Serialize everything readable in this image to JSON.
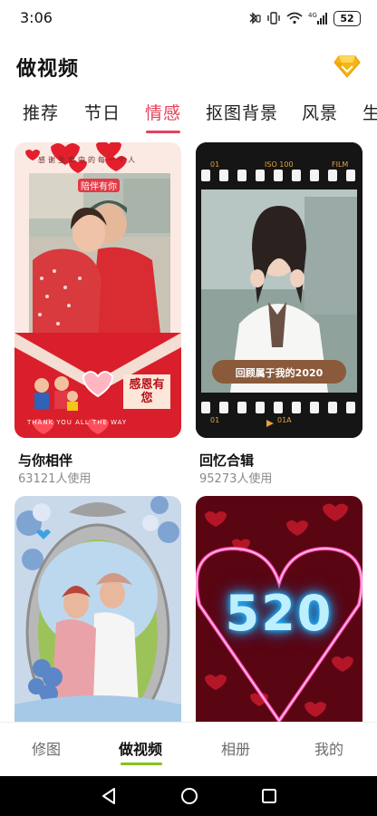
{
  "status": {
    "time": "3:06",
    "battery": "52"
  },
  "header": {
    "title": "做视频",
    "vip_icon": "diamond-icon"
  },
  "tabs": [
    {
      "label": "推荐"
    },
    {
      "label": "节日"
    },
    {
      "label": "情感",
      "active": true
    },
    {
      "label": "抠图背景"
    },
    {
      "label": "风景"
    },
    {
      "label": "生"
    }
  ],
  "templates": [
    {
      "title": "与你相伴",
      "usage": "63121人使用",
      "overlay_top": "感谢生命中的每一个人",
      "overlay_banner": "陪伴有你",
      "overlay_side": "感恩有您",
      "overlay_bottom": "THANK YOU ALL THE WAY"
    },
    {
      "title": "回忆合辑",
      "usage": "95273人使用",
      "film_tl": "01",
      "film_tm": "ISO 100",
      "film_tr": "FILM",
      "caption": "回顾属于我的2020",
      "film_bl": "01",
      "film_bm": "01A"
    },
    {
      "title": "",
      "usage": ""
    },
    {
      "title": "",
      "usage": "",
      "neon_number": "520"
    }
  ],
  "bottom_nav": [
    {
      "label": "修图"
    },
    {
      "label": "做视频",
      "active": true
    },
    {
      "label": "相册"
    },
    {
      "label": "我的"
    }
  ],
  "colors": {
    "accent": "#e5415c",
    "nav_indicator": "#86c21e"
  }
}
